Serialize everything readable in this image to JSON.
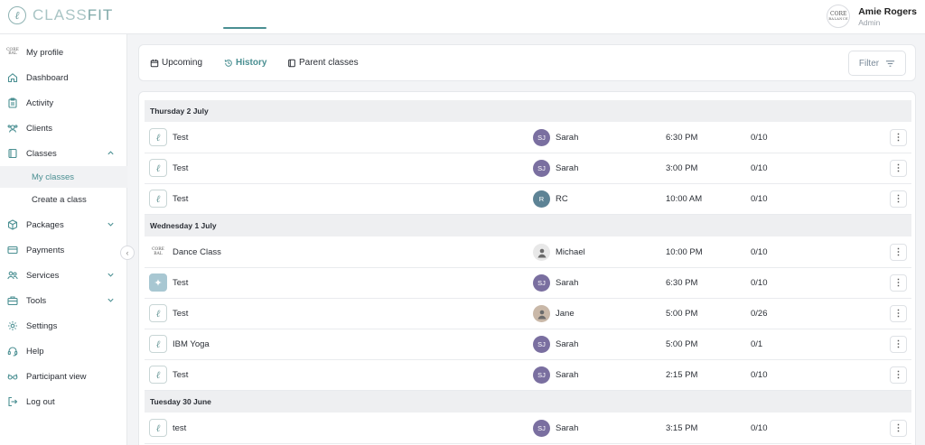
{
  "brand": {
    "name_light": "CLASS",
    "name_bold": "FIT"
  },
  "user": {
    "name": "Amie Rogers",
    "role": "Admin",
    "avatar_line1": "CORE",
    "avatar_line2": "BALANCE"
  },
  "sidebar": {
    "items": [
      {
        "label": "My profile",
        "icon": "profile-logo"
      },
      {
        "label": "Dashboard",
        "icon": "home-icon"
      },
      {
        "label": "Activity",
        "icon": "clipboard-icon"
      },
      {
        "label": "Clients",
        "icon": "clients-icon"
      },
      {
        "label": "Classes",
        "icon": "book-icon",
        "expanded": true
      },
      {
        "label": "Packages",
        "icon": "box-icon"
      },
      {
        "label": "Payments",
        "icon": "card-icon"
      },
      {
        "label": "Services",
        "icon": "people-icon"
      },
      {
        "label": "Tools",
        "icon": "toolbox-icon"
      },
      {
        "label": "Settings",
        "icon": "gear-icon"
      },
      {
        "label": "Help",
        "icon": "headset-icon"
      },
      {
        "label": "Participant view",
        "icon": "glasses-icon"
      },
      {
        "label": "Log out",
        "icon": "logout-icon"
      }
    ],
    "sub_items": [
      {
        "label": "My classes",
        "active": true
      },
      {
        "label": "Create a class",
        "active": false
      }
    ]
  },
  "tabs": [
    {
      "label": "Upcoming",
      "active": false
    },
    {
      "label": "History",
      "active": true
    },
    {
      "label": "Parent classes",
      "active": false
    }
  ],
  "filter_label": "Filter",
  "accent_color": "#4a8f92",
  "days": [
    {
      "label": "Thursday 2 July",
      "classes": [
        {
          "name": "Test",
          "thumb": "logo",
          "initials": "SJ",
          "avatar_color": "#7a6fa0",
          "instructor": "Sarah",
          "time": "6:30 PM",
          "capacity": "0/10"
        },
        {
          "name": "Test",
          "thumb": "logo",
          "initials": "SJ",
          "avatar_color": "#7a6fa0",
          "instructor": "Sarah",
          "time": "3:00 PM",
          "capacity": "0/10"
        },
        {
          "name": "Test",
          "thumb": "logo",
          "initials": "R",
          "avatar_color": "#5d8395",
          "instructor": "RC",
          "time": "10:00 AM",
          "capacity": "0/10"
        }
      ]
    },
    {
      "label": "Wednesday 1 July",
      "classes": [
        {
          "name": "Dance Class",
          "thumb": "core",
          "initials": "",
          "avatar_color": "#e8e8e8",
          "instructor": "Michael",
          "time": "10:00 PM",
          "capacity": "0/10"
        },
        {
          "name": "Test",
          "thumb": "photo",
          "initials": "SJ",
          "avatar_color": "#7a6fa0",
          "instructor": "Sarah",
          "time": "6:30 PM",
          "capacity": "0/10"
        },
        {
          "name": "Test",
          "thumb": "logo",
          "initials": "",
          "avatar_color": "#c9b8a8",
          "instructor": "Jane",
          "time": "5:00 PM",
          "capacity": "0/26"
        },
        {
          "name": "IBM Yoga",
          "thumb": "logo",
          "initials": "SJ",
          "avatar_color": "#7a6fa0",
          "instructor": "Sarah",
          "time": "5:00 PM",
          "capacity": "0/1"
        },
        {
          "name": "Test",
          "thumb": "logo",
          "initials": "SJ",
          "avatar_color": "#7a6fa0",
          "instructor": "Sarah",
          "time": "2:15 PM",
          "capacity": "0/10"
        }
      ]
    },
    {
      "label": "Tuesday 30 June",
      "classes": [
        {
          "name": "test",
          "thumb": "logo",
          "initials": "SJ",
          "avatar_color": "#7a6fa0",
          "instructor": "Sarah",
          "time": "3:15 PM",
          "capacity": "0/10"
        }
      ]
    }
  ]
}
